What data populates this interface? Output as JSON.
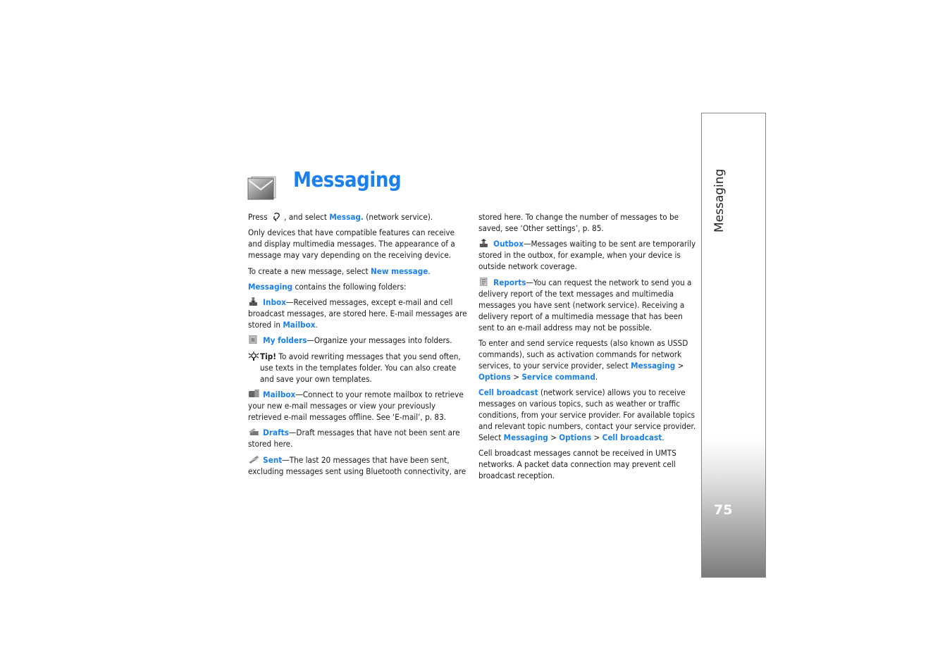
{
  "header": {
    "icon": "envelope-icon",
    "title": "Messaging"
  },
  "sidebar": {
    "section_label": "Messaging",
    "page_number": "75"
  },
  "left_column": {
    "press": {
      "pre": "Press",
      "icon": "menu-key-icon",
      "mid": ", and select",
      "link": "Messag.",
      "post": "(network service)."
    },
    "intro_lines": [
      "Only devices that have compatible features can receive",
      "and display multimedia messages. The appearance of a",
      "message may vary depending on the receiving device."
    ],
    "create": {
      "pre": "To create a new message, select",
      "link": "New message",
      "post": "."
    },
    "contains": {
      "link": "Messaging",
      "post": "contains the following folders:"
    },
    "inbox": {
      "icon": "inbox-icon",
      "link": "Inbox",
      "line1": "—Received messages, except e-mail and cell",
      "line2": "broadcast messages, are stored here. E-mail messages are",
      "line3_pre": "stored in",
      "line3_link": "Mailbox",
      "line3_post": "."
    },
    "my_folders": {
      "icon": "folder-icon",
      "link": "My folders",
      "text": "—Organize your messages into folders."
    },
    "tip": {
      "icon": "tip-lightbulb-icon",
      "label": "Tip!",
      "line1": "To avoid rewriting messages that you send often,",
      "line2": "use texts in the templates folder. You can also create",
      "line3": "and save your own templates."
    },
    "mailbox": {
      "icon": "mailbox-icon",
      "link": "Mailbox",
      "line1": "—Connect to your remote mailbox to retrieve",
      "line2": "your new e-mail messages or view your previously",
      "line3": "retrieved e-mail messages offline. See ‘E-mail’, p. 83."
    },
    "drafts": {
      "icon": "drafts-icon",
      "link": "Drafts",
      "line1": "—Draft messages that have not been sent are",
      "line2": "stored here."
    },
    "sent": {
      "icon": "sent-icon",
      "link": "Sent",
      "line1": "—The last 20 messages that have been sent,",
      "line2": "excluding messages sent using Bluetooth connectivity, are"
    }
  },
  "right_column": {
    "sent_cont": [
      "stored here. To change the number of messages to be",
      "saved, see ‘Other settings’, p. 85."
    ],
    "outbox": {
      "icon": "outbox-icon",
      "link": "Outbox",
      "line1": "—Messages waiting to be sent are temporarily",
      "line2": "stored in the outbox, for example, when your device is",
      "line3": "outside network coverage."
    },
    "reports": {
      "icon": "reports-icon",
      "link": "Reports",
      "line1": "—You can request the network to send you a",
      "line2": "delivery report of the text messages and multimedia",
      "line3": "messages you have sent (network service). Receiving a",
      "line4": "delivery report of a multimedia message that has been",
      "line5": "sent to an e-mail address may not be possible."
    },
    "service": {
      "line1": "To enter and send service requests (also known as USSD",
      "line2": "commands), such as activation commands for network",
      "line3_pre": "services, to your service provider, select",
      "line3_link": "Messaging",
      "sep": ">",
      "line4_link1": "Options",
      "line4_link2": "Service command",
      "line4_post": "."
    },
    "cell_broadcast": {
      "link": "Cell broadcast",
      "line1": "(network service) allows you to receive",
      "line2": "messages on various topics, such as weather or traffic",
      "line3": "conditions, from your service provider. For available topics",
      "line4": "and relevant topic numbers, contact your service provider.",
      "line5_pre": "Select",
      "line5_link1": "Messaging",
      "line5_link2": "Options",
      "line5_link3": "Cell broadcast",
      "line5_post": "."
    },
    "umts_note": [
      "Cell broadcast messages cannot be received in UMTS",
      "networks. A packet data connection may prevent cell",
      "broadcast reception."
    ]
  }
}
